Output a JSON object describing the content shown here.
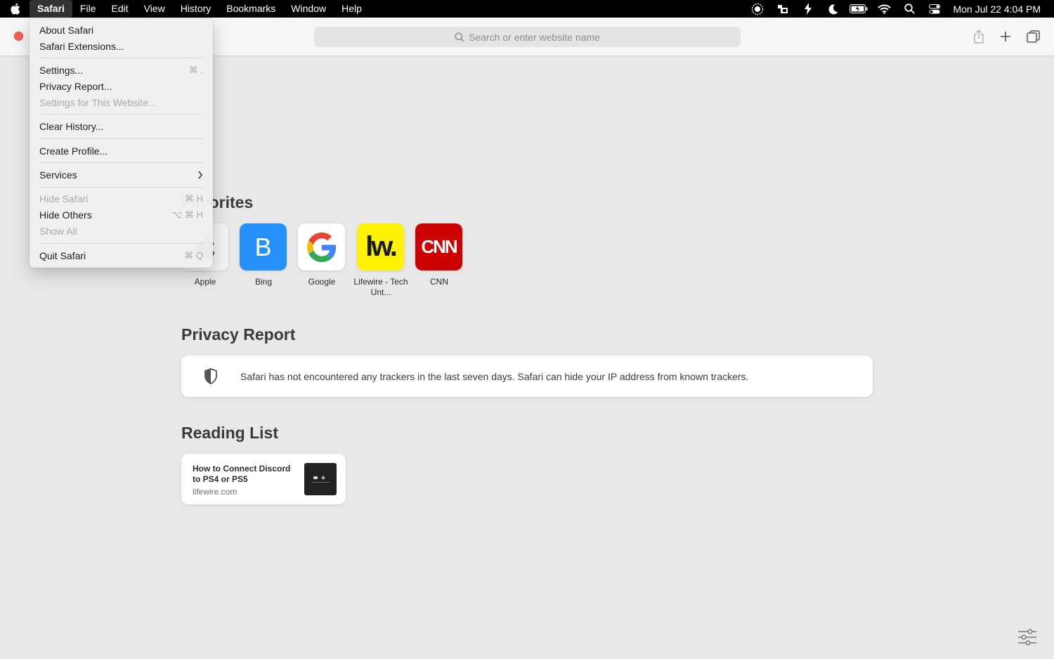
{
  "menubar": {
    "app_menu": "Safari",
    "items": [
      "File",
      "Edit",
      "View",
      "History",
      "Bookmarks",
      "Window",
      "Help"
    ],
    "status_icons": [
      "screen-record-icon",
      "stage-manager-icon",
      "bolt-icon",
      "moon-icon",
      "battery-icon",
      "wifi-icon",
      "search-icon",
      "control-center-icon"
    ],
    "clock": "Mon Jul 22  4:04 PM"
  },
  "toolbar": {
    "search_placeholder": "Search or enter website name"
  },
  "favorites": {
    "title": "Favorites",
    "items": [
      {
        "label": "Apple"
      },
      {
        "label": "Bing",
        "glyph": "B",
        "color": "#258ffa"
      },
      {
        "label": "Google"
      },
      {
        "label": "Lifewire - Tech Unt...",
        "glyph": "lw.",
        "color": "#fef200"
      },
      {
        "label": "CNN",
        "glyph": "CNN",
        "color": "#cc0000"
      }
    ]
  },
  "privacy": {
    "title": "Privacy Report",
    "message": "Safari has not encountered any trackers in the last seven days. Safari can hide your IP address from known trackers."
  },
  "reading_list": {
    "title": "Reading List",
    "items": [
      {
        "title": "How to Connect Discord to PS4 or PS5",
        "domain": "lifewire.com"
      }
    ]
  },
  "dropdown": {
    "about": "About Safari",
    "extensions": "Safari Extensions...",
    "settings": "Settings...",
    "settings_shortcut": "⌘ ,",
    "privacy_report": "Privacy Report...",
    "settings_website": "Settings for This Website...",
    "clear_history": "Clear History...",
    "create_profile": "Create Profile...",
    "services": "Services",
    "hide_safari": "Hide Safari",
    "hide_safari_shortcut": "⌘ H",
    "hide_others": "Hide Others",
    "hide_others_shortcut": "⌥ ⌘ H",
    "show_all": "Show All",
    "quit": "Quit Safari",
    "quit_shortcut": "⌘ Q"
  }
}
